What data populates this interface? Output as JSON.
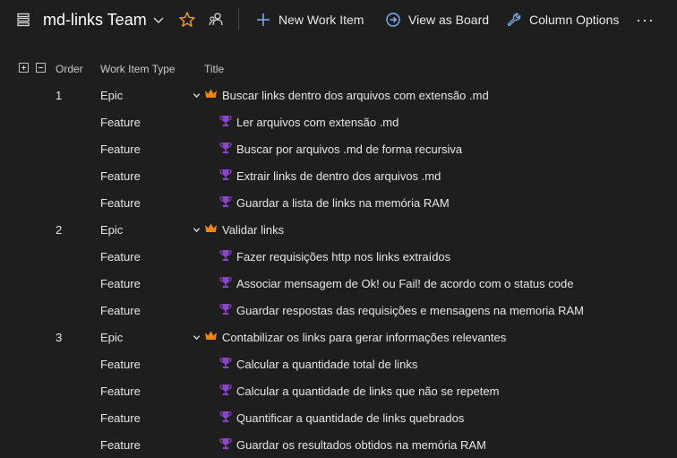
{
  "toolbar": {
    "team_name": "md-links Team",
    "new_work_item": "New Work Item",
    "view_as_board": "View as Board",
    "column_options": "Column Options",
    "more": "···"
  },
  "columns": {
    "order": "Order",
    "type": "Work Item Type",
    "title": "Title"
  },
  "colors": {
    "epic_icon": "#f2850f",
    "feature_icon": "#8a46c9",
    "star": "#f2a01e",
    "accent": "#5b9bd5"
  },
  "rows": [
    {
      "order": "1",
      "type": "Epic",
      "title": "Buscar links dentro dos arquivos com extensão .md",
      "icon": "crown-icon"
    },
    {
      "order": "",
      "type": "Feature",
      "title": "Ler arquivos com extensão .md",
      "icon": "trophy-icon"
    },
    {
      "order": "",
      "type": "Feature",
      "title": "Buscar por arquivos .md de forma recursiva",
      "icon": "trophy-icon"
    },
    {
      "order": "",
      "type": "Feature",
      "title": "Extrair links de dentro dos arquivos .md",
      "icon": "trophy-icon"
    },
    {
      "order": "",
      "type": "Feature",
      "title": "Guardar a lista de links na memória RAM",
      "icon": "trophy-icon"
    },
    {
      "order": "2",
      "type": "Epic",
      "title": "Validar links",
      "icon": "crown-icon"
    },
    {
      "order": "",
      "type": "Feature",
      "title": "Fazer requisições http nos links extraídos",
      "icon": "trophy-icon"
    },
    {
      "order": "",
      "type": "Feature",
      "title": "Associar mensagem de Ok! ou Fail! de acordo com o status code",
      "icon": "trophy-icon"
    },
    {
      "order": "",
      "type": "Feature",
      "title": "Guardar respostas das requisições e mensagens na memoria RAM",
      "icon": "trophy-icon"
    },
    {
      "order": "3",
      "type": "Epic",
      "title": "Contabilizar os links para gerar informações relevantes",
      "icon": "crown-icon"
    },
    {
      "order": "",
      "type": "Feature",
      "title": "Calcular a quantidade total de links",
      "icon": "trophy-icon"
    },
    {
      "order": "",
      "type": "Feature",
      "title": "Calcular a quantidade de links que não se repetem",
      "icon": "trophy-icon"
    },
    {
      "order": "",
      "type": "Feature",
      "title": "Quantificar a quantidade de links quebrados",
      "icon": "trophy-icon"
    },
    {
      "order": "",
      "type": "Feature",
      "title": "Guardar os resultados obtidos na memória RAM",
      "icon": "trophy-icon"
    }
  ]
}
